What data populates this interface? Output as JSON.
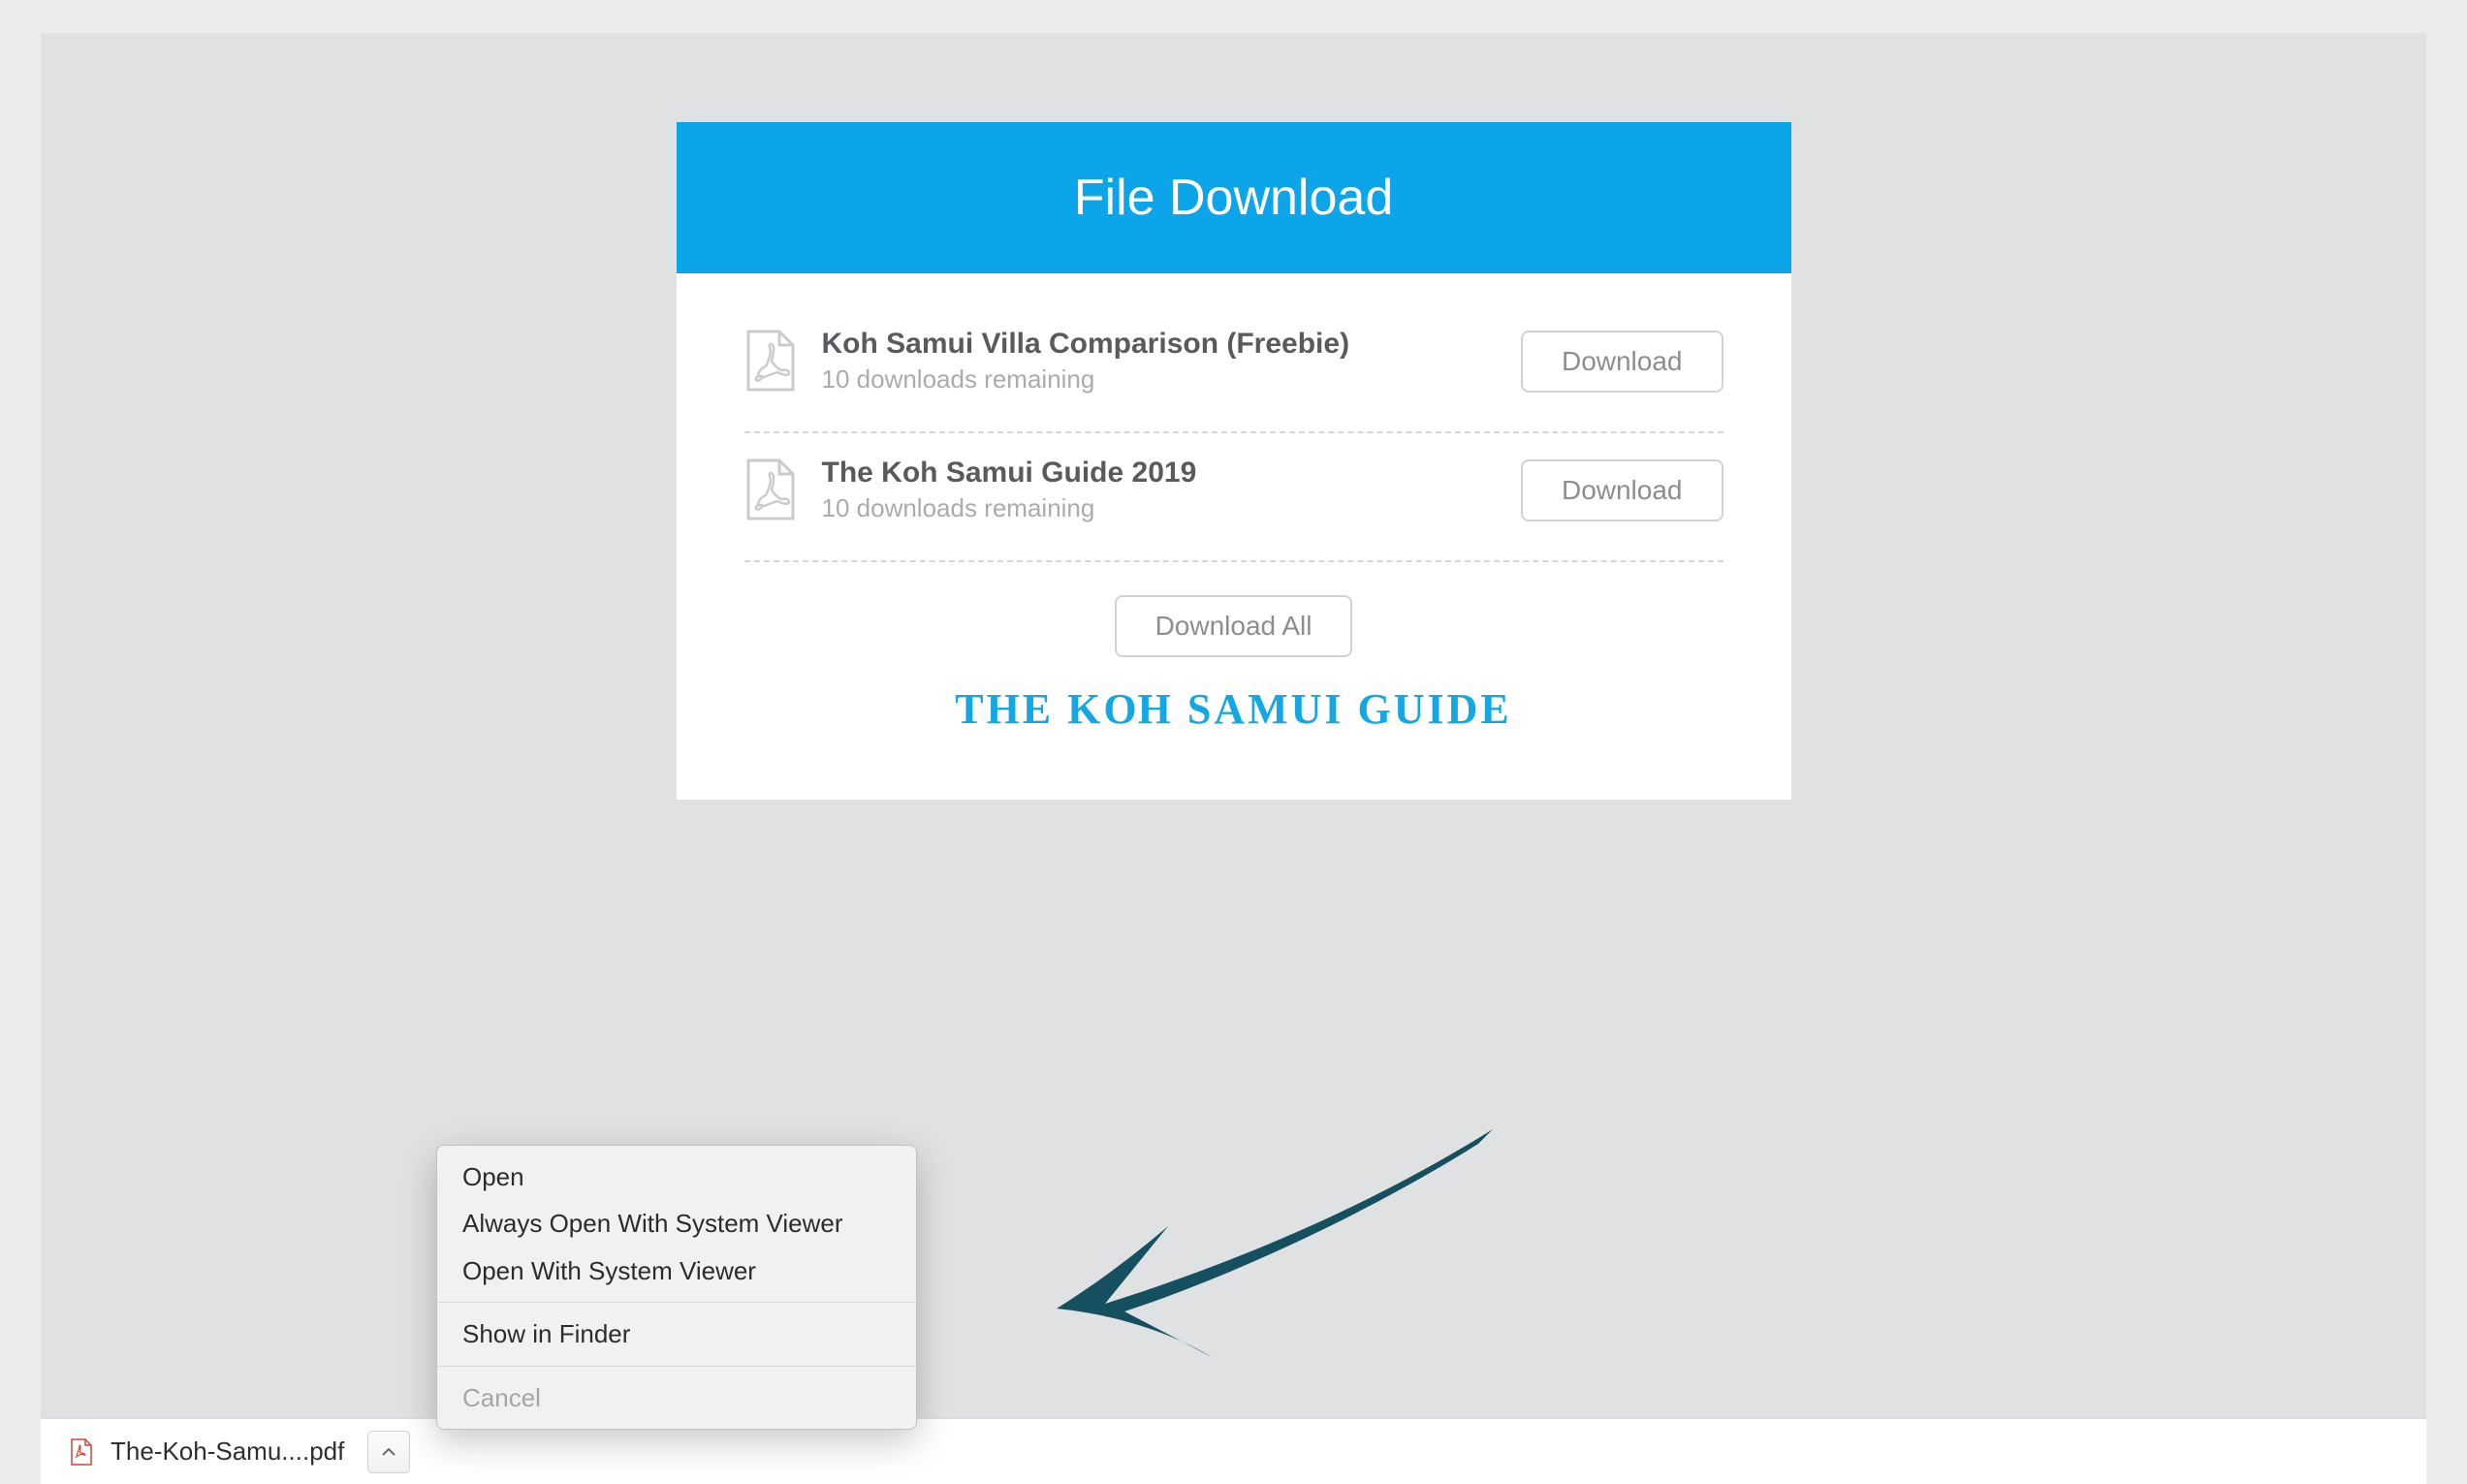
{
  "card": {
    "title": "File Download",
    "files": [
      {
        "title": "Koh Samui Villa Comparison (Freebie)",
        "subtitle": "10 downloads remaining",
        "button": "Download"
      },
      {
        "title": "The Koh Samui Guide 2019",
        "subtitle": "10 downloads remaining",
        "button": "Download"
      }
    ],
    "download_all": "Download All",
    "brand": "THE KOH SAMUI GUIDE"
  },
  "download_bar": {
    "filename": "The-Koh-Samu....pdf"
  },
  "context_menu": {
    "open": "Open",
    "always_open": "Always Open With System Viewer",
    "open_with": "Open With System Viewer",
    "show_finder": "Show in Finder",
    "cancel": "Cancel"
  },
  "colors": {
    "accent": "#0ca5e9",
    "arrow": "#14505f"
  }
}
